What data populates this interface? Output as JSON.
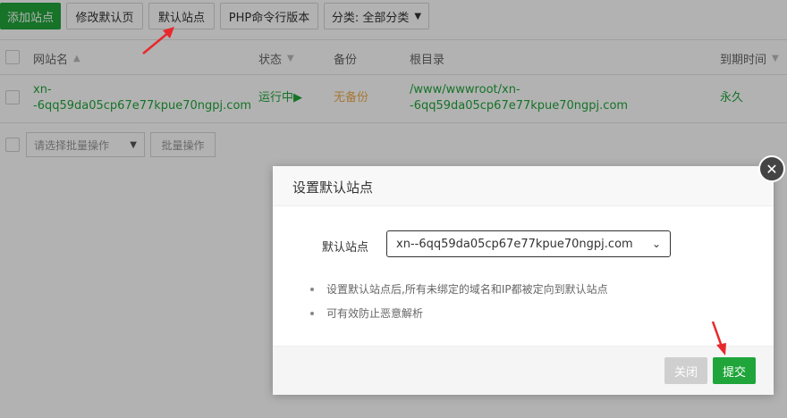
{
  "toolbar": {
    "add_site": "添加站点",
    "edit_default_page": "修改默认页",
    "default_site": "默认站点",
    "php_cli_version": "PHP命令行版本",
    "category_filter": "分类: 全部分类"
  },
  "table": {
    "headers": {
      "site_name": "网站名",
      "status": "状态",
      "backup": "备份",
      "root_dir": "根目录",
      "expire": "到期时间"
    },
    "row": {
      "site_line1": "xn-",
      "site_line2": "-6qq59da05cp67e77kpue70ngpj.com",
      "status": "运行中",
      "backup": "无备份",
      "root_line1": "/www/wwwroot/xn-",
      "root_line2": "-6qq59da05cp67e77kpue70ngpj.com",
      "expire": "永久"
    },
    "batch_select_placeholder": "请选择批量操作",
    "batch_button": "批量操作"
  },
  "dialog": {
    "title": "设置默认站点",
    "field_label": "默认站点",
    "selected_site": "xn--6qq59da05cp67e77kpue70ngpj.com",
    "tips": [
      "设置默认站点后,所有未绑定的域名和IP都被定向到默认站点",
      "可有效防止恶意解析"
    ],
    "close_button": "关闭",
    "submit_button": "提交"
  },
  "colors": {
    "accent_green": "#20a53a",
    "annotation_red": "#e8292c",
    "warning_orange": "#f0ad4e"
  }
}
